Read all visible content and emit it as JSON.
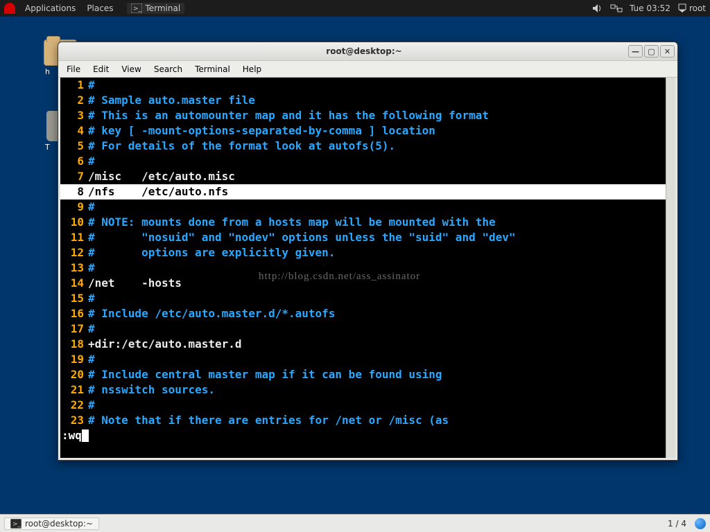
{
  "panel": {
    "apps": "Applications",
    "places": "Places",
    "task": "Terminal",
    "clock": "Tue 03:52",
    "user": "root"
  },
  "desktop": {
    "home_label": "h",
    "trash_label": "T"
  },
  "window": {
    "title": "root@desktop:~",
    "menu": [
      "File",
      "Edit",
      "View",
      "Search",
      "Terminal",
      "Help"
    ]
  },
  "editor": {
    "lines": [
      {
        "n": "1",
        "t": "#",
        "cls": ""
      },
      {
        "n": "2",
        "t": "# Sample auto.master file",
        "cls": ""
      },
      {
        "n": "3",
        "t": "# This is an automounter map and it has the following format",
        "cls": ""
      },
      {
        "n": "4",
        "t": "# key [ -mount-options-separated-by-comma ] location",
        "cls": ""
      },
      {
        "n": "5",
        "t": "# For details of the format look at autofs(5).",
        "cls": ""
      },
      {
        "n": "6",
        "t": "#",
        "cls": ""
      },
      {
        "n": "7",
        "t": "/misc   /etc/auto.misc",
        "cls": "plain"
      },
      {
        "n": "8",
        "t": "/nfs    /etc/auto.nfs",
        "cls": "cur"
      },
      {
        "n": "9",
        "t": "#",
        "cls": ""
      },
      {
        "n": "10",
        "t": "# NOTE: mounts done from a hosts map will be mounted with the",
        "cls": ""
      },
      {
        "n": "11",
        "t": "#       \"nosuid\" and \"nodev\" options unless the \"suid\" and \"dev\"",
        "cls": ""
      },
      {
        "n": "12",
        "t": "#       options are explicitly given.",
        "cls": ""
      },
      {
        "n": "13",
        "t": "#",
        "cls": ""
      },
      {
        "n": "14",
        "t": "/net    -hosts",
        "cls": "plain"
      },
      {
        "n": "15",
        "t": "#",
        "cls": ""
      },
      {
        "n": "16",
        "t": "# Include /etc/auto.master.d/*.autofs",
        "cls": ""
      },
      {
        "n": "17",
        "t": "#",
        "cls": ""
      },
      {
        "n": "18",
        "t": "+dir:/etc/auto.master.d",
        "cls": "plain"
      },
      {
        "n": "19",
        "t": "#",
        "cls": ""
      },
      {
        "n": "20",
        "t": "# Include central master map if it can be found using",
        "cls": ""
      },
      {
        "n": "21",
        "t": "# nsswitch sources.",
        "cls": ""
      },
      {
        "n": "22",
        "t": "#",
        "cls": ""
      },
      {
        "n": "23",
        "t": "# Note that if there are entries for /net or /misc (as",
        "cls": ""
      }
    ],
    "cmd": ":wq",
    "watermark": "http://blog.csdn.net/ass_assinator"
  },
  "bottom": {
    "task": "root@desktop:~",
    "workspace": "1 / 4"
  }
}
